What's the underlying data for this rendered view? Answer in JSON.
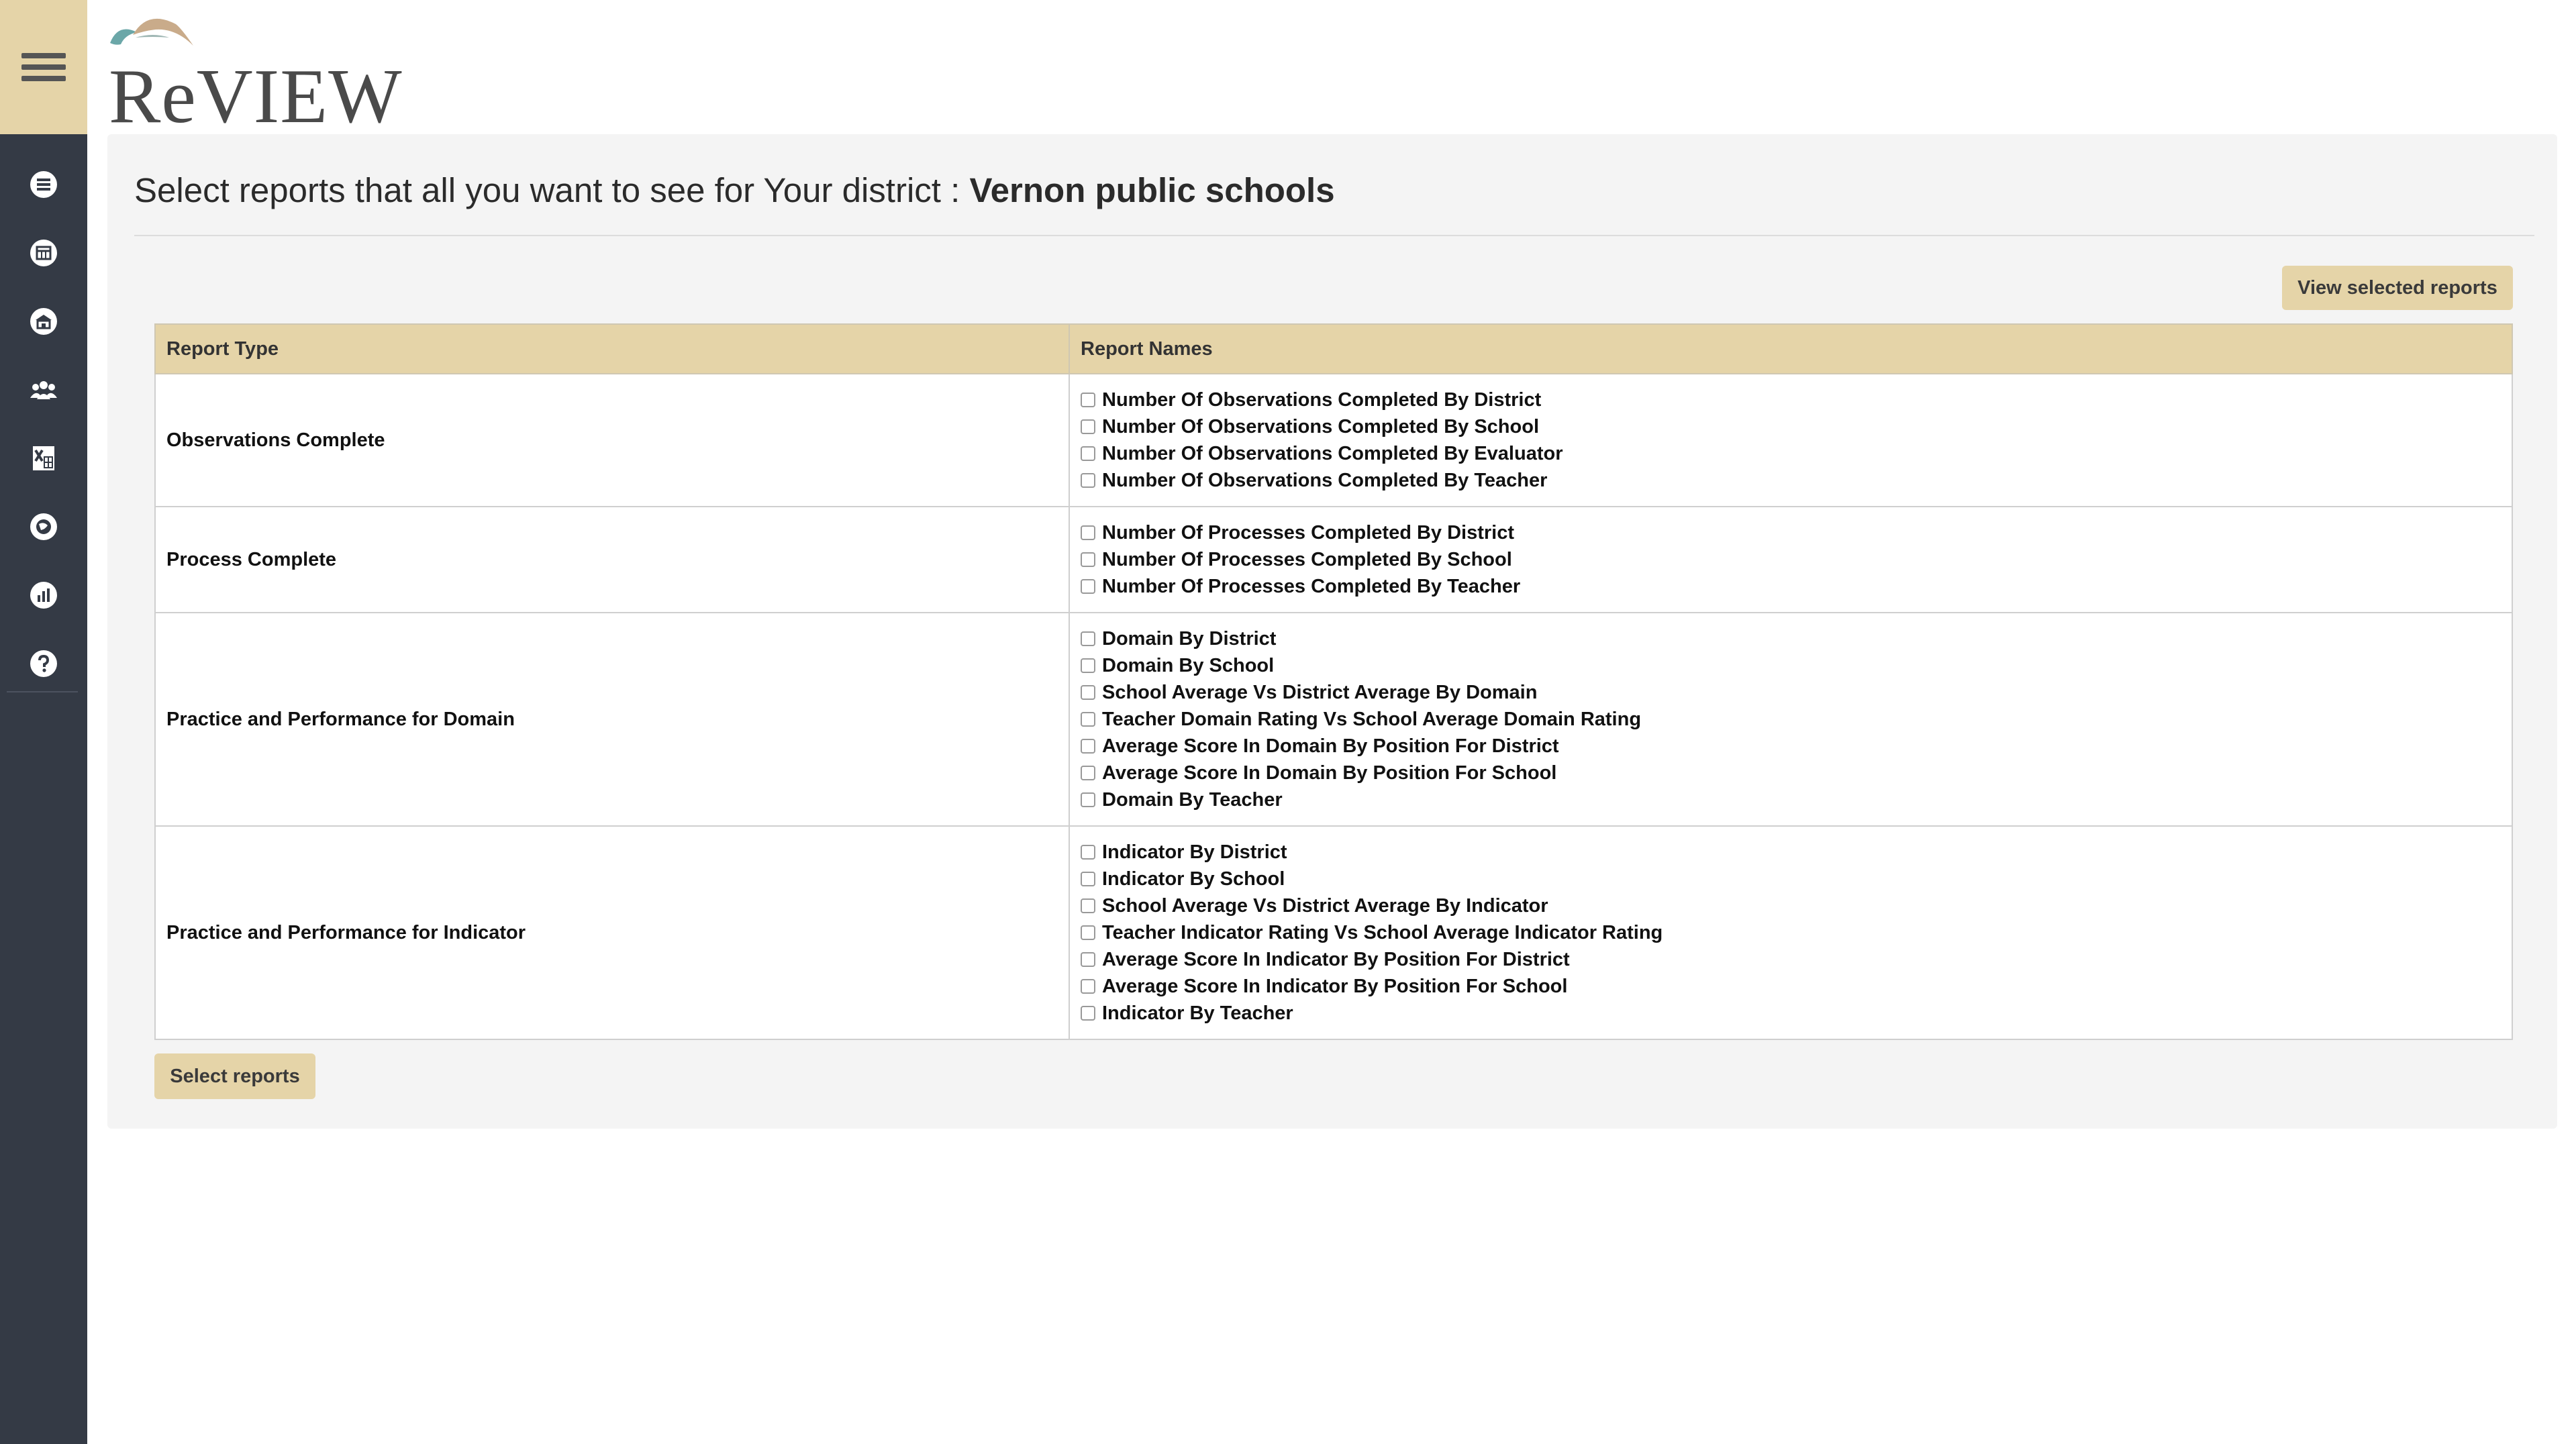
{
  "logo": {
    "text": "ReVIEW"
  },
  "sidebar": {
    "items": [
      {
        "icon": "list-icon"
      },
      {
        "icon": "calendar-icon"
      },
      {
        "icon": "school-icon"
      },
      {
        "icon": "users-icon"
      },
      {
        "icon": "excel-icon"
      },
      {
        "icon": "globe-icon"
      },
      {
        "icon": "bar-chart-icon"
      },
      {
        "icon": "help-icon"
      }
    ]
  },
  "header": {
    "prefix": "Select reports that all you want to see for Your district : ",
    "district": "Vernon public schools"
  },
  "buttons": {
    "view_selected": "View selected reports",
    "select_reports": "Select reports"
  },
  "table": {
    "col_type": "Report Type",
    "col_names": "Report Names",
    "groups": [
      {
        "type": "Observations Complete",
        "reports": [
          "Number Of Observations Completed By District",
          "Number Of Observations Completed By School",
          "Number Of Observations Completed By Evaluator",
          "Number Of Observations Completed By Teacher"
        ]
      },
      {
        "type": "Process Complete",
        "reports": [
          "Number Of Processes Completed By District",
          "Number Of Processes Completed By School",
          "Number Of Processes Completed By Teacher"
        ]
      },
      {
        "type": "Practice and Performance for Domain",
        "reports": [
          "Domain By District",
          "Domain By School",
          "School Average Vs District Average By Domain",
          "Teacher Domain Rating Vs School Average Domain Rating",
          "Average Score In Domain By Position For District",
          "Average Score In Domain By Position For School",
          "Domain By Teacher"
        ]
      },
      {
        "type": "Practice and Performance for Indicator",
        "reports": [
          "Indicator By District",
          "Indicator By School",
          "School Average Vs District Average By Indicator",
          "Teacher Indicator Rating Vs School Average Indicator Rating",
          "Average Score In Indicator By Position For District",
          "Average Score In Indicator By Position For School",
          "Indicator By Teacher"
        ]
      }
    ]
  },
  "colors": {
    "sidebar": "#343a45",
    "accent": "#e5d4a8",
    "panel": "#f4f4f4"
  }
}
